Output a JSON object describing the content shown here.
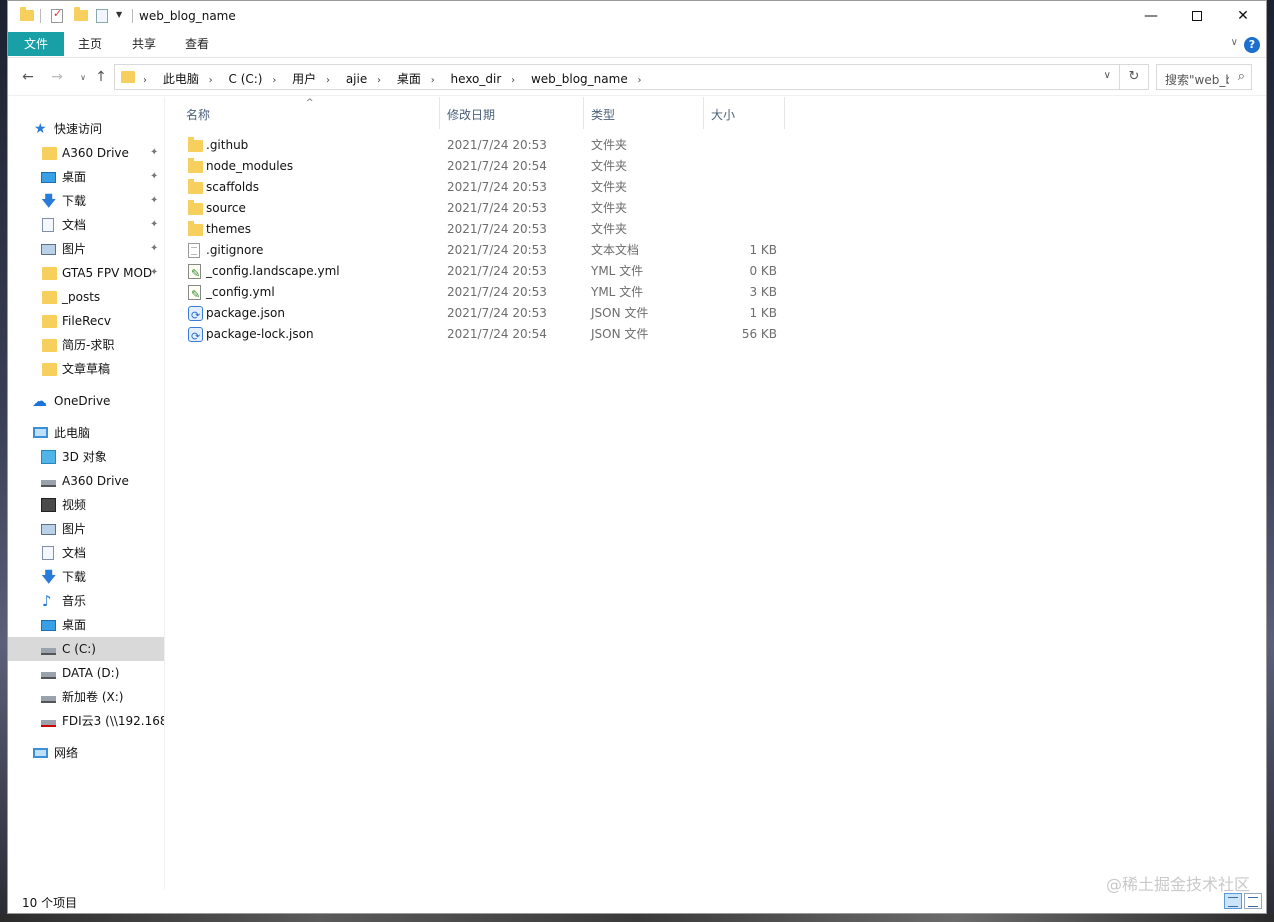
{
  "window": {
    "title": "web_blog_name",
    "min_glyph": "—",
    "close_glyph": "✕"
  },
  "ribbon": {
    "tabs": [
      "文件",
      "主页",
      "共享",
      "查看"
    ],
    "help_label": "?"
  },
  "address": {
    "crumbs": [
      "此电脑",
      "C (C:)",
      "用户",
      "ajie",
      "桌面",
      "hexo_dir",
      "web_blog_name"
    ],
    "separator": "›",
    "search_placeholder": "搜索\"web_blog_name\""
  },
  "nav": {
    "back": "←",
    "forward": "→",
    "recent": "∨",
    "up": "↑",
    "refresh": "↻",
    "dropdown": "∨",
    "search_glyph": "⌕"
  },
  "sidebar": {
    "pin_glyph": "✦",
    "items": [
      {
        "label": "快速访问",
        "icon": "star-icon"
      },
      {
        "label": "A360 Drive",
        "icon": "folder-icon",
        "pinned": true
      },
      {
        "label": "桌面",
        "icon": "desktop-icon",
        "pinned": true
      },
      {
        "label": "下载",
        "icon": "download-icon",
        "pinned": true
      },
      {
        "label": "文档",
        "icon": "document-icon",
        "pinned": true
      },
      {
        "label": "图片",
        "icon": "pictures-icon",
        "pinned": true
      },
      {
        "label": "GTA5 FPV MOD",
        "icon": "folder-icon",
        "pinned": true
      },
      {
        "label": "_posts",
        "icon": "folder-icon"
      },
      {
        "label": "FileRecv",
        "icon": "folder-icon"
      },
      {
        "label": "简历-求职",
        "icon": "folder-icon"
      },
      {
        "label": "文章草稿",
        "icon": "folder-icon"
      },
      {
        "label": "OneDrive",
        "icon": "cloud-icon"
      },
      {
        "label": "此电脑",
        "icon": "computer-icon"
      },
      {
        "label": "3D 对象",
        "icon": "3d-objects-icon"
      },
      {
        "label": "A360 Drive",
        "icon": "a360-drive-icon"
      },
      {
        "label": "视频",
        "icon": "video-icon"
      },
      {
        "label": "图片",
        "icon": "pictures-icon"
      },
      {
        "label": "文档",
        "icon": "document-icon"
      },
      {
        "label": "下载",
        "icon": "download-icon"
      },
      {
        "label": "音乐",
        "icon": "music-icon"
      },
      {
        "label": "桌面",
        "icon": "desktop-icon"
      },
      {
        "label": "C (C:)",
        "icon": "drive-icon",
        "selected": true
      },
      {
        "label": "DATA (D:)",
        "icon": "drive-icon"
      },
      {
        "label": "新加卷 (X:)",
        "icon": "drive-icon"
      },
      {
        "label": "FDI云3 (\\\\192.168.",
        "icon": "network-drive-icon"
      },
      {
        "label": "网络",
        "icon": "network-icon"
      }
    ]
  },
  "columns": {
    "name": "名称",
    "date": "修改日期",
    "type": "类型",
    "size": "大小",
    "sort_glyph": "^"
  },
  "files": [
    {
      "name": ".github",
      "date": "2021/7/24 20:53",
      "type": "文件夹",
      "size": "",
      "icon": "folder-icon"
    },
    {
      "name": "node_modules",
      "date": "2021/7/24 20:54",
      "type": "文件夹",
      "size": "",
      "icon": "folder-icon"
    },
    {
      "name": "scaffolds",
      "date": "2021/7/24 20:53",
      "type": "文件夹",
      "size": "",
      "icon": "folder-icon"
    },
    {
      "name": "source",
      "date": "2021/7/24 20:53",
      "type": "文件夹",
      "size": "",
      "icon": "folder-icon"
    },
    {
      "name": "themes",
      "date": "2021/7/24 20:53",
      "type": "文件夹",
      "size": "",
      "icon": "folder-icon"
    },
    {
      "name": ".gitignore",
      "date": "2021/7/24 20:53",
      "type": "文本文档",
      "size": "1 KB",
      "icon": "text-file-icon"
    },
    {
      "name": "_config.landscape.yml",
      "date": "2021/7/24 20:53",
      "type": "YML 文件",
      "size": "0 KB",
      "icon": "yml-file-icon"
    },
    {
      "name": "_config.yml",
      "date": "2021/7/24 20:53",
      "type": "YML 文件",
      "size": "3 KB",
      "icon": "yml-file-icon"
    },
    {
      "name": "package.json",
      "date": "2021/7/24 20:53",
      "type": "JSON 文件",
      "size": "1 KB",
      "icon": "json-file-icon"
    },
    {
      "name": "package-lock.json",
      "date": "2021/7/24 20:54",
      "type": "JSON 文件",
      "size": "56 KB",
      "icon": "json-file-icon"
    }
  ],
  "status": {
    "item_count": "10 个项目"
  },
  "watermark": "@稀土掘金技术社区"
}
